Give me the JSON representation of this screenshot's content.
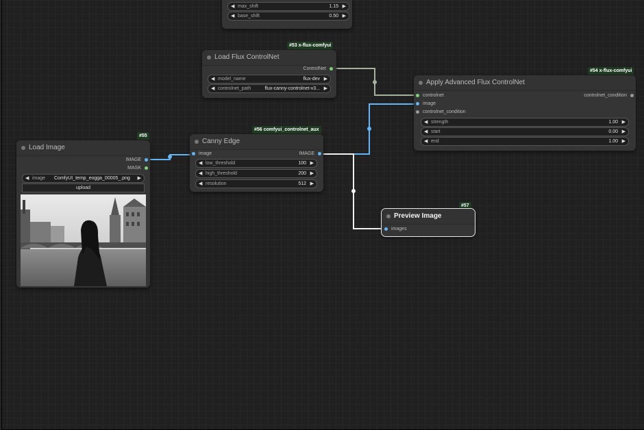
{
  "top_node": {
    "widgets": [
      {
        "label": "max_shift",
        "value": "1.15"
      },
      {
        "label": "base_shift",
        "value": "0.50"
      }
    ]
  },
  "load_flux": {
    "badge": "#53 x-flux-comfyui",
    "title": "Load Flux ControlNet",
    "output": "ControlNet",
    "widgets": [
      {
        "label": "model_name",
        "value": "flux-dev"
      },
      {
        "label": "controlnet_path",
        "value": "flux-canny-controlnet-v3..."
      }
    ]
  },
  "apply": {
    "badge": "#54 x-flux-comfyui",
    "title": "Apply Advanced Flux ControlNet",
    "inputs": [
      "controlnet",
      "image",
      "controlnet_condition"
    ],
    "output": "controlnet_condition",
    "widgets": [
      {
        "label": "strength",
        "value": "1.00"
      },
      {
        "label": "start",
        "value": "0.00"
      },
      {
        "label": "end",
        "value": "1.00"
      }
    ]
  },
  "load_image": {
    "badge": "#55",
    "title": "Load Image",
    "outputs": [
      "IMAGE",
      "MASK"
    ],
    "widget": {
      "label": "image",
      "value": "ComfyUI_temp_eogga_00005_.png"
    },
    "upload": "upload"
  },
  "canny": {
    "badge": "#56 comfyui_controlnet_aux",
    "title": "Canny Edge",
    "input": "image",
    "output": "IMAGE",
    "widgets": [
      {
        "label": "low_threshold",
        "value": "100"
      },
      {
        "label": "high_threshold",
        "value": "200"
      },
      {
        "label": "resolution",
        "value": "512"
      }
    ]
  },
  "preview": {
    "badge": "#57",
    "title": "Preview Image",
    "input": "images"
  },
  "colors": {
    "canvas": "#202020",
    "node": "#353535",
    "image_link": "#64b5f6",
    "controlnet_link": "#a5b39e",
    "badge": "#1f3c23"
  }
}
